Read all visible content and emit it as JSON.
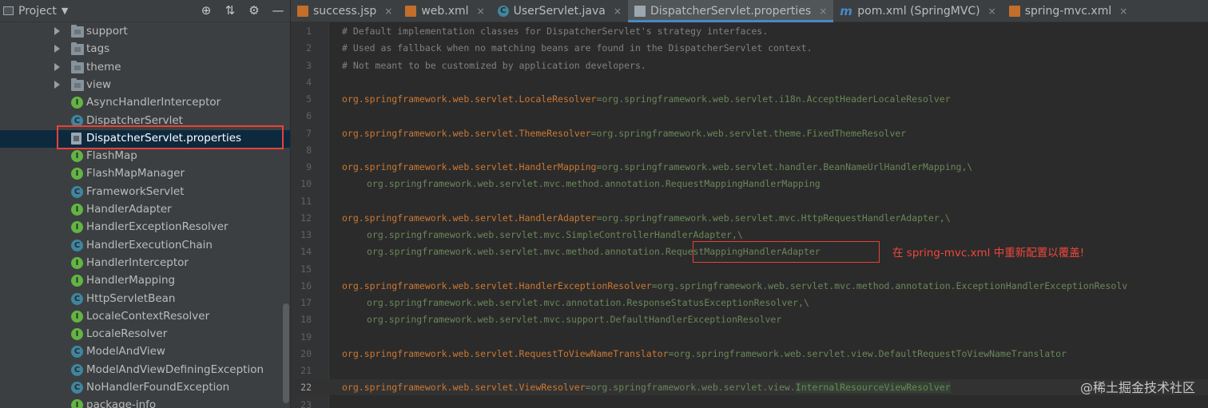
{
  "project_panel": {
    "title": "Project",
    "toolbar_icons": [
      "globe-target-icon",
      "collapse-all-icon",
      "gear-icon",
      "minimize-icon"
    ],
    "tree": [
      {
        "label": "support",
        "type": "folder"
      },
      {
        "label": "tags",
        "type": "folder"
      },
      {
        "label": "theme",
        "type": "folder"
      },
      {
        "label": "view",
        "type": "folder"
      },
      {
        "label": "AsyncHandlerInterceptor",
        "type": "interface"
      },
      {
        "label": "DispatcherServlet",
        "type": "class"
      },
      {
        "label": "DispatcherServlet.properties",
        "type": "properties",
        "selected": true
      },
      {
        "label": "FlashMap",
        "type": "interface"
      },
      {
        "label": "FlashMapManager",
        "type": "interface"
      },
      {
        "label": "FrameworkServlet",
        "type": "abstract-class"
      },
      {
        "label": "HandlerAdapter",
        "type": "interface"
      },
      {
        "label": "HandlerExceptionResolver",
        "type": "interface"
      },
      {
        "label": "HandlerExecutionChain",
        "type": "class"
      },
      {
        "label": "HandlerInterceptor",
        "type": "interface"
      },
      {
        "label": "HandlerMapping",
        "type": "interface"
      },
      {
        "label": "HttpServletBean",
        "type": "abstract-class"
      },
      {
        "label": "LocaleContextResolver",
        "type": "interface"
      },
      {
        "label": "LocaleResolver",
        "type": "interface"
      },
      {
        "label": "ModelAndView",
        "type": "class"
      },
      {
        "label": "ModelAndViewDefiningException",
        "type": "class"
      },
      {
        "label": "NoHandlerFoundException",
        "type": "class"
      },
      {
        "label": "package-info",
        "type": "interface"
      }
    ]
  },
  "tabs": [
    {
      "label": "success.jsp",
      "icon": "jsp-file-icon",
      "active": false
    },
    {
      "label": "web.xml",
      "icon": "xml-file-icon",
      "active": false
    },
    {
      "label": "UserServlet.java",
      "icon": "java-class-icon",
      "active": false
    },
    {
      "label": "DispatcherServlet.properties",
      "icon": "properties-file-icon",
      "active": true
    },
    {
      "label": "pom.xml (SpringMVC)",
      "icon": "maven-icon",
      "active": false
    },
    {
      "label": "spring-mvc.xml",
      "icon": "xml-file-icon",
      "active": false
    }
  ],
  "editor": {
    "current_line": "22",
    "lines": [
      {
        "num": "1",
        "kind": "comment",
        "text": "# Default implementation classes for DispatcherServlet's strategy interfaces."
      },
      {
        "num": "2",
        "kind": "comment",
        "text": "# Used as fallback when no matching beans are found in the DispatcherServlet context."
      },
      {
        "num": "3",
        "kind": "comment",
        "text": "# Not meant to be customized by application developers."
      },
      {
        "num": "4",
        "kind": "empty",
        "text": ""
      },
      {
        "num": "5",
        "kind": "prop",
        "key": "org.springframework.web.servlet.LocaleResolver",
        "value": "org.springframework.web.servlet.i18n.AcceptHeaderLocaleResolver"
      },
      {
        "num": "6",
        "kind": "empty",
        "text": ""
      },
      {
        "num": "7",
        "kind": "prop",
        "key": "org.springframework.web.servlet.ThemeResolver",
        "value": "org.springframework.web.servlet.theme.FixedThemeResolver"
      },
      {
        "num": "8",
        "kind": "empty",
        "text": ""
      },
      {
        "num": "9",
        "kind": "prop",
        "key": "org.springframework.web.servlet.HandlerMapping",
        "value": "org.springframework.web.servlet.handler.BeanNameUrlHandlerMapping,\\"
      },
      {
        "num": "10",
        "kind": "cont",
        "text": "org.springframework.web.servlet.mvc.method.annotation.RequestMappingHandlerMapping"
      },
      {
        "num": "11",
        "kind": "empty",
        "text": ""
      },
      {
        "num": "12",
        "kind": "prop",
        "key": "org.springframework.web.servlet.HandlerAdapter",
        "value": "org.springframework.web.servlet.mvc.HttpRequestHandlerAdapter,\\"
      },
      {
        "num": "13",
        "kind": "cont",
        "text": "org.springframework.web.servlet.mvc.SimpleControllerHandlerAdapter,\\"
      },
      {
        "num": "14",
        "kind": "cont",
        "text": "org.springframework.web.servlet.mvc.method.annotation.RequestMappingHandlerAdapter"
      },
      {
        "num": "15",
        "kind": "empty",
        "text": ""
      },
      {
        "num": "16",
        "kind": "prop",
        "key": "org.springframework.web.servlet.HandlerExceptionResolver",
        "value": "org.springframework.web.servlet.mvc.method.annotation.ExceptionHandlerExceptionResolv"
      },
      {
        "num": "17",
        "kind": "cont",
        "text": "org.springframework.web.servlet.mvc.annotation.ResponseStatusExceptionResolver,\\"
      },
      {
        "num": "18",
        "kind": "cont",
        "text": "org.springframework.web.servlet.mvc.support.DefaultHandlerExceptionResolver"
      },
      {
        "num": "19",
        "kind": "empty",
        "text": ""
      },
      {
        "num": "20",
        "kind": "prop",
        "key": "org.springframework.web.servlet.RequestToViewNameTranslator",
        "value": "org.springframework.web.servlet.view.DefaultRequestToViewNameTranslator"
      },
      {
        "num": "21",
        "kind": "empty",
        "text": ""
      },
      {
        "num": "22",
        "kind": "prop",
        "key": "org.springframework.web.servlet.ViewResolver",
        "value": "org.springframework.web.servlet.view.",
        "value_hl": "InternalResourceViewResolver"
      },
      {
        "num": "23",
        "kind": "empty",
        "text": ""
      }
    ]
  },
  "annotation": {
    "text": "在 spring-mvc.xml 中重新配置以覆盖!",
    "highlighted_term": "RequestMappingHandlerAdapter"
  },
  "watermark": "@稀土掘金技术社区",
  "colors": {
    "panel_bg": "#3c3f41",
    "editor_bg": "#2b2b2b",
    "comment": "#808080",
    "key": "#cc7832",
    "value": "#6a8759",
    "selection": "#0d293e",
    "annotation_red": "#e8413a",
    "active_tab_underline": "#4a88c7"
  }
}
